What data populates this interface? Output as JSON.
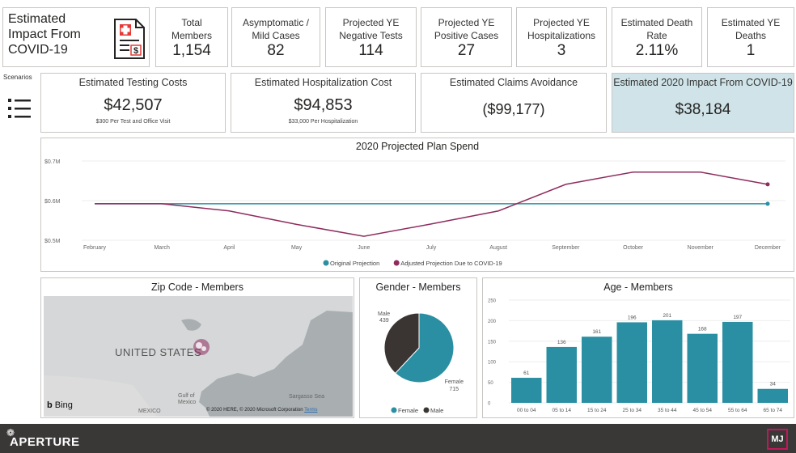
{
  "header": {
    "title": "Estimated Impact From COVID-19",
    "scenarios_label": "Scenarios"
  },
  "kpis": [
    {
      "label": "Total Members",
      "value": "1,154"
    },
    {
      "label": "Asymptomatic / Mild Cases",
      "value": "82"
    },
    {
      "label": "Projected YE Negative Tests",
      "value": "114"
    },
    {
      "label": "Projected YE Positive Cases",
      "value": "27"
    },
    {
      "label": "Projected YE Hospitalizations",
      "value": "3"
    },
    {
      "label": "Estimated Death Rate",
      "value": "2.11%"
    },
    {
      "label": "Estimated YE Deaths",
      "value": "1"
    }
  ],
  "costs": [
    {
      "label": "Estimated Testing Costs",
      "value": "$42,507",
      "sub": "$300 Per Test and Office Visit"
    },
    {
      "label": "Estimated Hospitalization Cost",
      "value": "$94,853",
      "sub": "$33,000 Per Hospitalization"
    },
    {
      "label": "Estimated Claims Avoidance",
      "value": "($99,177)",
      "sub": ""
    },
    {
      "label": "Estimated 2020 Impact From COVID-19",
      "value": "$38,184",
      "sub": ""
    }
  ],
  "colors": {
    "teal": "#2b8fa3",
    "maroon": "#8e2c5e",
    "highlight": "#cfe3e8",
    "dark": "#3a3837"
  },
  "chart_data": [
    {
      "type": "line",
      "title": "2020 Projected Plan Spend",
      "x": [
        "February",
        "March",
        "April",
        "May",
        "June",
        "July",
        "August",
        "September",
        "October",
        "November",
        "December"
      ],
      "ylim": [
        0.5,
        0.7
      ],
      "yticks": [
        "$0.5M",
        "$0.6M",
        "$0.7M"
      ],
      "series": [
        {
          "name": "Original Projection",
          "color": "#2b8fa3",
          "values": [
            0.592,
            0.592,
            0.592,
            0.592,
            0.592,
            0.592,
            0.592,
            0.592,
            0.592,
            0.592,
            0.592
          ]
        },
        {
          "name": "Adjusted Projection Due to COVID-19",
          "color": "#8e2c5e",
          "values": [
            0.592,
            0.592,
            0.574,
            0.54,
            0.51,
            0.541,
            0.574,
            0.641,
            0.672,
            0.672,
            0.641
          ]
        }
      ],
      "legend": "bottom"
    },
    {
      "type": "pie",
      "title": "Gender - Members",
      "categories": [
        "Female",
        "Male"
      ],
      "values": [
        715,
        439
      ],
      "colors": [
        "#2b8fa3",
        "#3a3432"
      ],
      "legend": "bottom"
    },
    {
      "type": "bar",
      "title": "Age - Members",
      "categories": [
        "00 to 04",
        "05 to 14",
        "15 to 24",
        "25 to 34",
        "35 to 44",
        "45 to 54",
        "55 to 64",
        "65 to 74"
      ],
      "values": [
        61,
        136,
        161,
        196,
        201,
        168,
        197,
        34
      ],
      "ylim": [
        0,
        250
      ],
      "yticks": [
        0,
        50,
        100,
        150,
        200,
        250
      ],
      "color": "#2b8fa3"
    }
  ],
  "map": {
    "title": "Zip Code - Members",
    "country_label": "UNITED STATES",
    "labels": [
      "Sargasso Sea",
      "Gulf of Mexico",
      "MEXICO"
    ],
    "bing": "Bing",
    "copyright": "© 2020 HERE, © 2020 Microsoft Corporation",
    "terms": "Terms"
  },
  "footer": {
    "brand": "APERTURE",
    "badge": "MJ"
  }
}
